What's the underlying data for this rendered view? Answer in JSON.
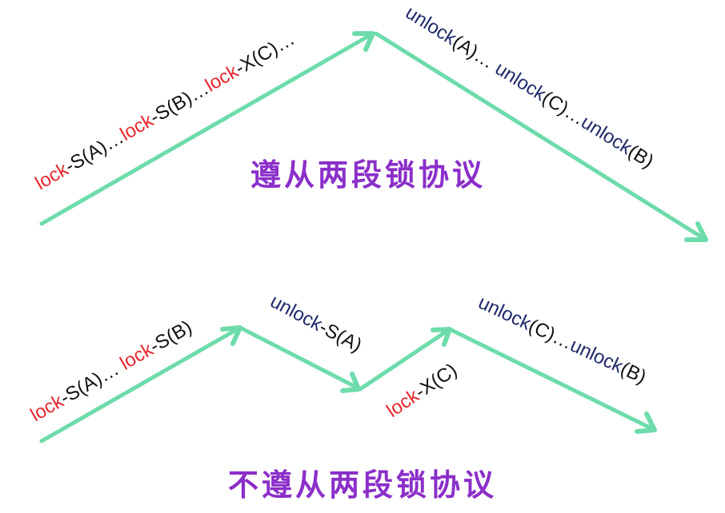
{
  "colors": {
    "arrow": "#6ddcaa",
    "lock": "#e8262d",
    "text_black": "#111111",
    "unlock": "#1f2a6b",
    "title": "#8b2fc9"
  },
  "top": {
    "grow_labels": [
      {
        "kw": "lock",
        "rest": "-S(A)…"
      },
      {
        "kw": "lock",
        "rest": "-S(B)…"
      },
      {
        "kw": "lock",
        "rest": "-X(C)…"
      }
    ],
    "shrink_labels": [
      {
        "kw": "unlock",
        "rest": "(A)… "
      },
      {
        "kw": "unlock",
        "rest": "(C)…"
      },
      {
        "kw": "unlock",
        "rest": "(B)"
      }
    ],
    "title": "遵从两段锁协议"
  },
  "bottom": {
    "seg1": [
      {
        "kw": "lock",
        "rest": "-S(A)… "
      },
      {
        "kw": "lock",
        "rest": "-S(B)"
      }
    ],
    "seg2": {
      "kw": "unlock",
      "rest": "-S(A)"
    },
    "seg3": {
      "kw": "lock",
      "rest": "-X(C)"
    },
    "seg4": [
      {
        "kw": "unlock",
        "rest": "(C)…"
      },
      {
        "kw": "unlock",
        "rest": "(B)"
      }
    ],
    "title": "不遵从两段锁协议"
  }
}
